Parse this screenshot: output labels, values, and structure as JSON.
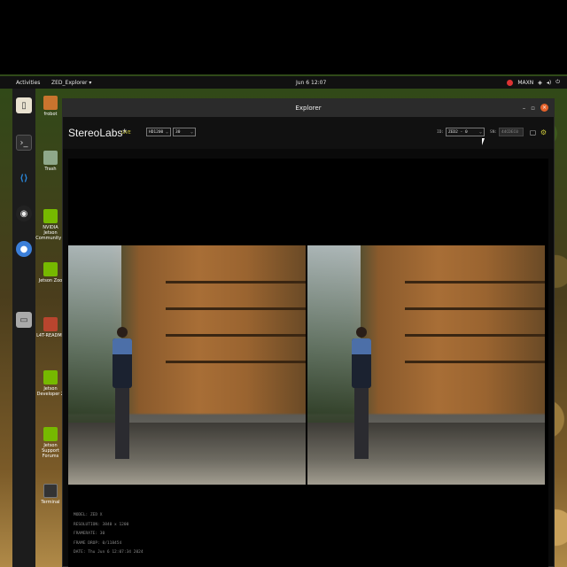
{
  "topbar": {
    "activities": "Activities",
    "app_menu": "ZED_Explorer ▾",
    "clock": "Jun 6 12:07",
    "power_mode": "MAXN"
  },
  "dock": {
    "items": [
      {
        "name": "files-icon"
      },
      {
        "name": "terminal-icon"
      },
      {
        "name": "vscode-icon"
      },
      {
        "name": "obs-icon"
      },
      {
        "name": "chromium-icon"
      },
      {
        "name": "disk-icon"
      }
    ]
  },
  "desktop": {
    "icons": [
      {
        "label": "frobot"
      },
      {
        "label": "Trash"
      },
      {
        "label": "NVIDIA Jetson Community P"
      },
      {
        "label": "Jetson Zoo"
      },
      {
        "label": "L4T-README"
      },
      {
        "label": "Jetson Developer Z"
      },
      {
        "label": "Jetson Support Forums"
      },
      {
        "label": "Terminal"
      }
    ]
  },
  "window": {
    "title": "Explorer",
    "brand": "StereoLabs*",
    "live": "LIVE",
    "resolution_select": "HD1200",
    "fps_select": "30",
    "id_label": "ID:",
    "id_value": "ZED2 - 0",
    "sn_label": "SN:",
    "sn_value": "44CDEC0"
  },
  "info": {
    "model": "MODEL: ZED X",
    "resolution": "RESOLUTION: 3840 x 1200",
    "framerate": "FRAMERATE: 30",
    "frame_drop": "FRAME DROP: 0/118454",
    "date": "DATE: Thu Jun 6 12:07:34 2024"
  },
  "colors": {
    "live": "#c9c53a",
    "close_button": "#e5622a"
  }
}
